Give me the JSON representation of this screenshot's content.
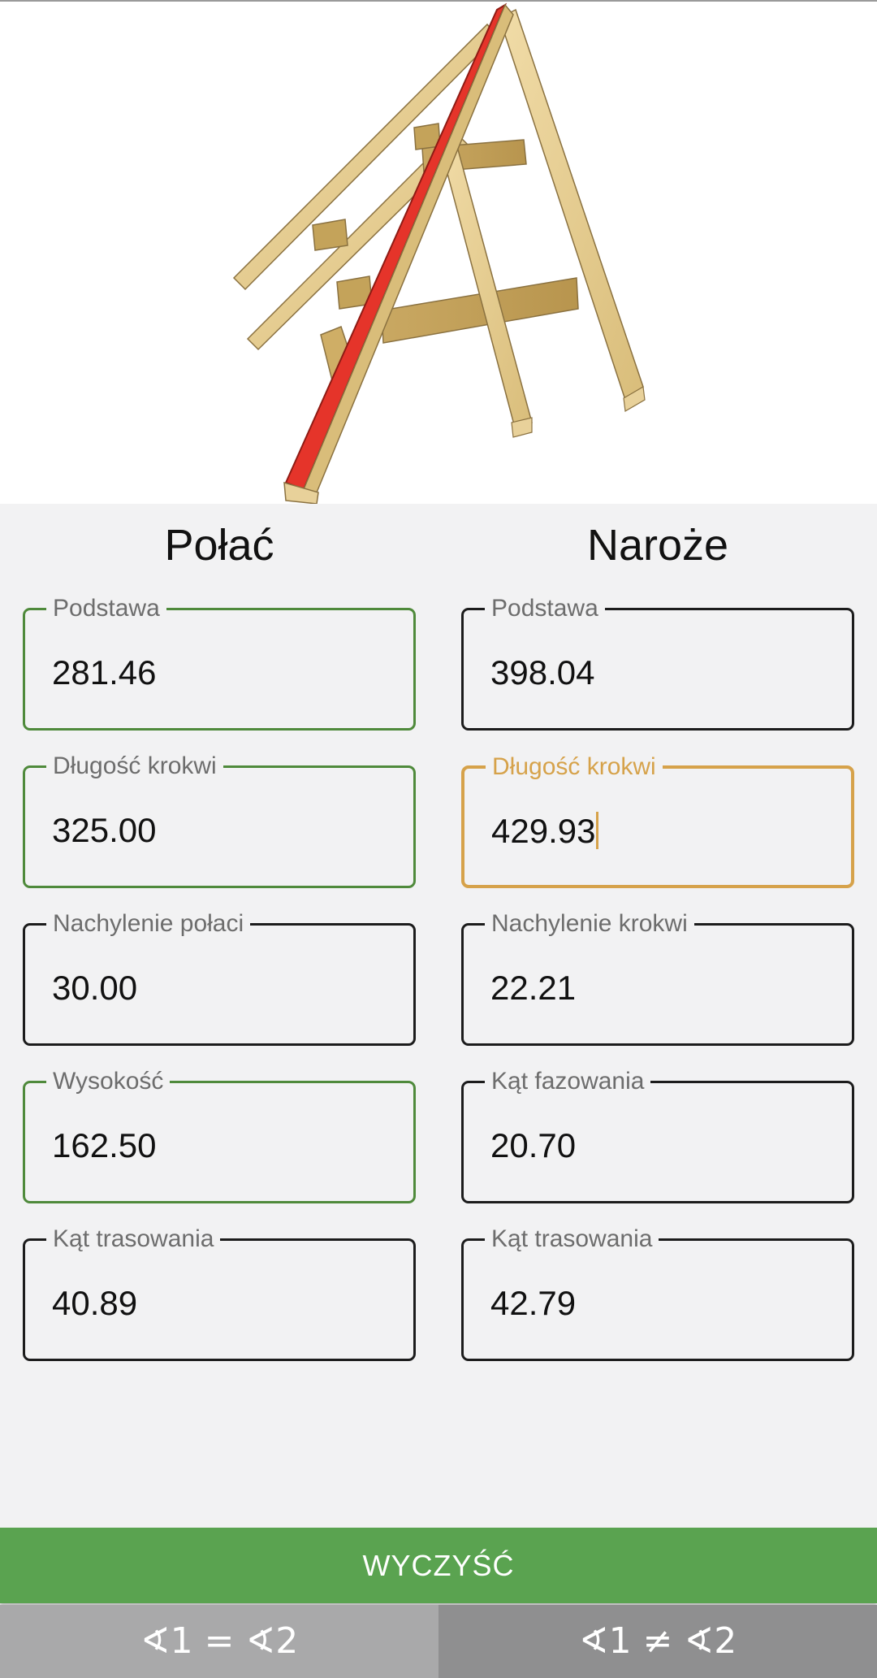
{
  "colors": {
    "valid_border": "#4f8a3b",
    "focus_border": "#d6a24a",
    "default_border": "#1c1c1c",
    "button_green": "#5aa350",
    "highlight_rafter": "#e5342a"
  },
  "illustration": {
    "icon": "roof-truss-3d-illustration"
  },
  "columns": {
    "left_title": "Połać",
    "right_title": "Naroże"
  },
  "left_fields": [
    {
      "label": "Podstawa",
      "value": "281.46",
      "state": "valid"
    },
    {
      "label": "Długość krokwi",
      "value": "325.00",
      "state": "valid"
    },
    {
      "label": "Nachylenie połaci",
      "value": "30.00",
      "state": "default"
    },
    {
      "label": "Wysokość",
      "value": "162.50",
      "state": "valid"
    },
    {
      "label": "Kąt trasowania",
      "value": "40.89",
      "state": "default"
    }
  ],
  "right_fields": [
    {
      "label": "Podstawa",
      "value": "398.04",
      "state": "default"
    },
    {
      "label": "Długość krokwi",
      "value": "429.93",
      "state": "focused"
    },
    {
      "label": "Nachylenie krokwi",
      "value": "22.21",
      "state": "default"
    },
    {
      "label": "Kąt fazowania",
      "value": "20.70",
      "state": "default"
    },
    {
      "label": "Kąt trasowania",
      "value": "42.79",
      "state": "default"
    }
  ],
  "buttons": {
    "clear": "WYCZYŚĆ",
    "mode_equal": "∢1 = ∢2",
    "mode_not_equal": "∢1 ≠ ∢2"
  }
}
